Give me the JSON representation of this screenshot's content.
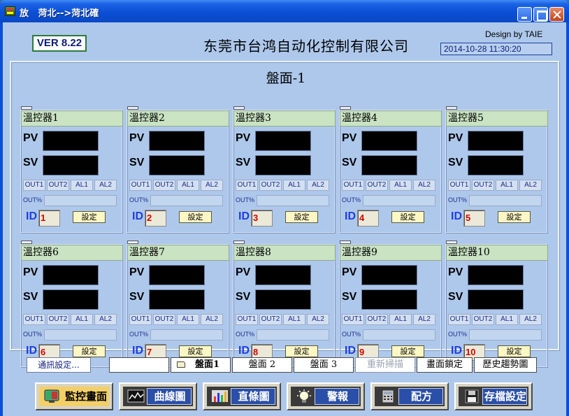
{
  "window": {
    "title": "放   菏北-->菏北確"
  },
  "header": {
    "version": "VER 8.22",
    "company": "东莞市台鸿自动化控制有限公司",
    "design_by": "Design by TAIE",
    "datetime": "2014-10-28 11:30:20"
  },
  "panel": {
    "title": "盤面-1"
  },
  "controller_common": {
    "pv_label": "PV",
    "sv_label": "SV",
    "indicators": [
      "OUT1",
      "OUT2",
      "AL1",
      "AL2"
    ],
    "out_percent_label": "OUT%",
    "id_label": "ID",
    "set_label": "設定"
  },
  "controllers": [
    {
      "name": "溫控器1",
      "id": "1"
    },
    {
      "name": "溫控器2",
      "id": "2"
    },
    {
      "name": "溫控器3",
      "id": "3"
    },
    {
      "name": "溫控器4",
      "id": "4"
    },
    {
      "name": "溫控器5",
      "id": "5"
    },
    {
      "name": "溫控器6",
      "id": "6"
    },
    {
      "name": "溫控器7",
      "id": "7"
    },
    {
      "name": "溫控器8",
      "id": "8"
    },
    {
      "name": "溫控器9",
      "id": "9"
    },
    {
      "name": "溫控器10",
      "id": "10"
    }
  ],
  "pagebar": {
    "comm_settings": "通訊設定...",
    "page1": "盤面1",
    "page2": "盤面 2",
    "page3": "盤面 3",
    "rescan": "重新掃描",
    "screen_lock": "畫面鎖定",
    "history_trend": "歷史趨勢圖"
  },
  "nav": [
    {
      "label": "監控畫面",
      "icon": "monitor-icon",
      "active": true
    },
    {
      "label": "曲線圖",
      "icon": "curve-chart-icon",
      "active": false
    },
    {
      "label": "直條圖",
      "icon": "bar-chart-icon",
      "active": false
    },
    {
      "label": "警報",
      "icon": "alarm-light-icon",
      "active": false
    },
    {
      "label": "配方",
      "icon": "recipe-calculator-icon",
      "active": false
    },
    {
      "label": "存檔設定",
      "icon": "floppy-disk-icon",
      "active": false
    }
  ],
  "colors": {
    "titlebar": "#0b4fd6",
    "client_bg": "#aec8ec",
    "controller_name_bg": "#c9e3c3",
    "display_bg": "#000000",
    "id_value": "#d40000",
    "id_label": "#1d3fe0",
    "set_button_bg": "#fdf7c5",
    "active_nav": "#f3cf68"
  }
}
